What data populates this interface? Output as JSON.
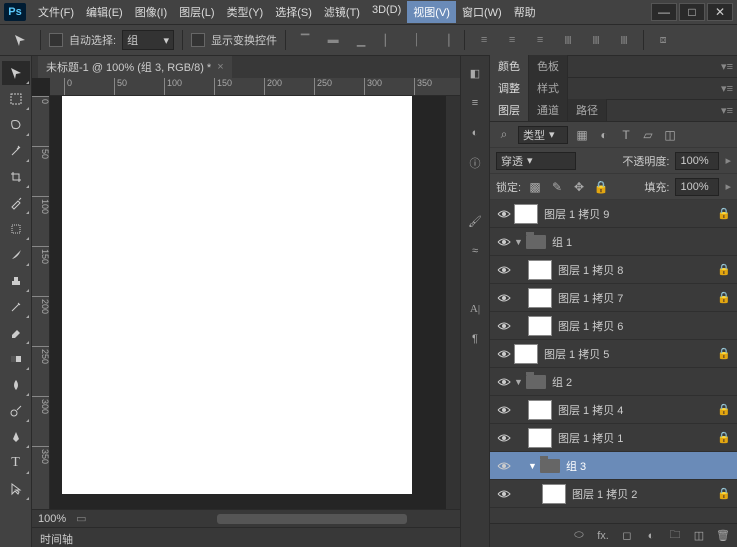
{
  "app": {
    "logo": "Ps"
  },
  "menu": [
    "文件(F)",
    "编辑(E)",
    "图像(I)",
    "图层(L)",
    "类型(Y)",
    "选择(S)",
    "滤镜(T)",
    "3D(D)",
    "视图(V)",
    "窗口(W)",
    "帮助"
  ],
  "active_menu_index": 8,
  "options": {
    "auto_select": "自动选择:",
    "group": "组",
    "transform_controls": "显示变换控件"
  },
  "doc_tab": "未标题-1 @ 100% (组 3, RGB/8) *",
  "ruler_h": [
    "0",
    "50",
    "100",
    "150",
    "200",
    "250",
    "300",
    "350"
  ],
  "ruler_v": [
    "0",
    "50",
    "100",
    "150",
    "200",
    "250",
    "300",
    "350"
  ],
  "zoom": "100%",
  "timeline": "时间轴",
  "panels": {
    "color_tabs": [
      "颜色",
      "色板"
    ],
    "adjust_tabs": [
      "调整",
      "样式"
    ],
    "layers_tabs": [
      "图层",
      "通道",
      "路径"
    ],
    "filter_label": "类型",
    "blend_mode": "穿透",
    "opacity_label": "不透明度:",
    "opacity_value": "100%",
    "lock_label": "锁定:",
    "fill_label": "填充:",
    "fill_value": "100%"
  },
  "layers": [
    {
      "name": "图层 1 拷贝 9",
      "type": "layer",
      "indent": 0,
      "locked": true
    },
    {
      "name": "组 1",
      "type": "folder",
      "indent": 0,
      "expanded": true
    },
    {
      "name": "图层 1 拷贝 8",
      "type": "layer",
      "indent": 1,
      "locked": true
    },
    {
      "name": "图层 1 拷贝 7",
      "type": "layer",
      "indent": 1,
      "locked": true
    },
    {
      "name": "图层 1 拷贝 6",
      "type": "layer",
      "indent": 1
    },
    {
      "name": "图层 1 拷贝 5",
      "type": "layer",
      "indent": 0,
      "locked": true
    },
    {
      "name": "组 2",
      "type": "folder",
      "indent": 0,
      "expanded": true
    },
    {
      "name": "图层 1 拷贝 4",
      "type": "layer",
      "indent": 1,
      "locked": true
    },
    {
      "name": "图层 1 拷贝 1",
      "type": "layer",
      "indent": 1,
      "locked": true
    },
    {
      "name": "组 3",
      "type": "folder",
      "indent": 1,
      "expanded": true,
      "selected": true
    },
    {
      "name": "图层 1 拷贝 2",
      "type": "layer",
      "indent": 2,
      "locked": true
    }
  ]
}
